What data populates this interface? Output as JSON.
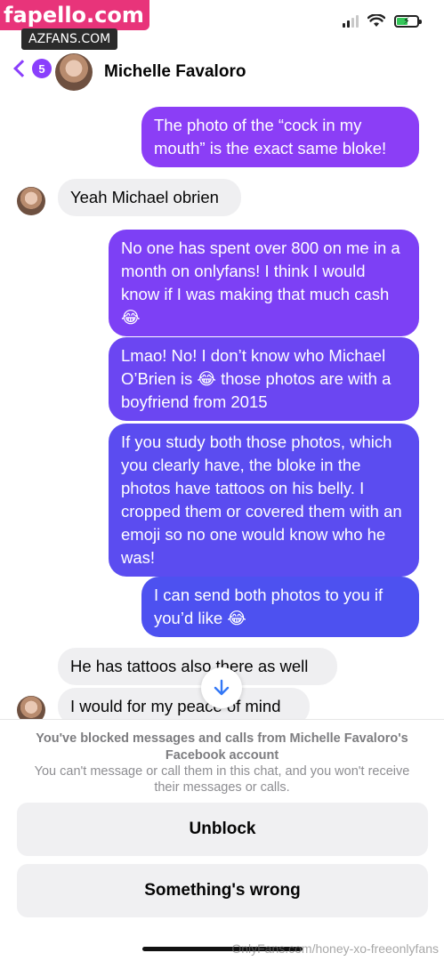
{
  "watermark": {
    "site": "fapello.com",
    "sub": "AZFANS.COM",
    "footer": "OnlyFans.com/honey-xo-freeonlyfans"
  },
  "header": {
    "back_count": "5",
    "contact_name": "Michelle Favaloro"
  },
  "messages": [
    {
      "text": "The photo of the “cock in my mouth” is the exact same bloke!"
    },
    {
      "text": "Yeah Michael obrien"
    },
    {
      "text": "No one has spent over 800 on me in a month on onlyfans! I think I would know if I was making that much cash 😂"
    },
    {
      "text": "Lmao! No! I don’t know who Michael O’Brien is 😂 those photos are with a boyfriend from 2015"
    },
    {
      "text": "If you study both those photos, which you clearly have, the bloke in the photos have tattoos on his belly. I cropped them or covered them with an emoji so no one would know who he was!"
    },
    {
      "text": "I can send both photos to you if you’d like 😂"
    },
    {
      "text": "He has tattoos also there as well"
    },
    {
      "text": "I would for my peace of mind"
    }
  ],
  "blocked": {
    "title": "You've blocked messages and calls from Michelle Favaloro's Facebook account",
    "subtitle": "You can't message or call them in this chat, and you won't receive their messages or calls.",
    "unblock_label": "Unblock",
    "wrong_label": "Something's wrong"
  },
  "colors": {
    "accent": "#8a3ffc",
    "bubble_top": "#8b3ef6",
    "bubble_bottom": "#4a52f0"
  }
}
